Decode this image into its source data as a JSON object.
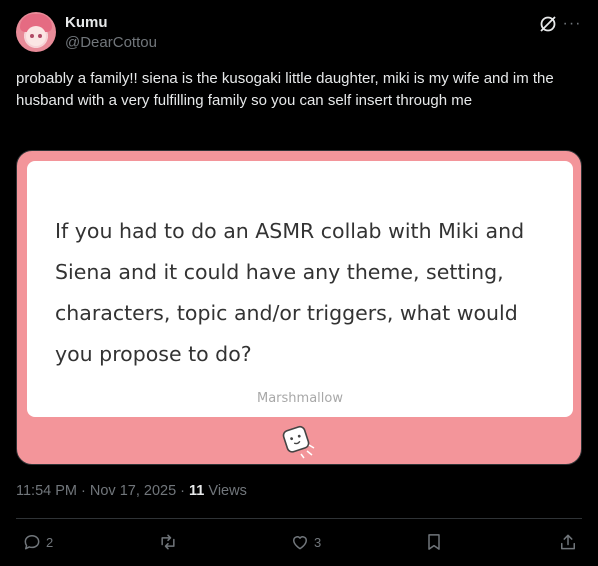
{
  "author": {
    "name": "Kumu",
    "handle": "@DearCottou"
  },
  "post": {
    "text": "probably a family!! siena is the kusogaki little daughter, miki is my wife and im the husband with a very fulfilling family so you can self insert through me"
  },
  "card": {
    "question": "If you had to do an ASMR collab with Miki and Siena and it could have any theme, setting, characters, topic and/or triggers, what would you propose to do?",
    "brand": "Marshmallow",
    "background_color": "#f3959a"
  },
  "meta": {
    "time": "11:54 PM",
    "separator": " · ",
    "date": "Nov 17, 2025",
    "views_count": "11",
    "views_label": "Views"
  },
  "actions": {
    "replies": "2",
    "reposts": "",
    "likes": "3"
  },
  "icons": [
    "grok-icon",
    "more-icon",
    "reply-icon",
    "repost-icon",
    "like-icon",
    "bookmark-icon",
    "share-icon",
    "marshmallow-icon"
  ]
}
